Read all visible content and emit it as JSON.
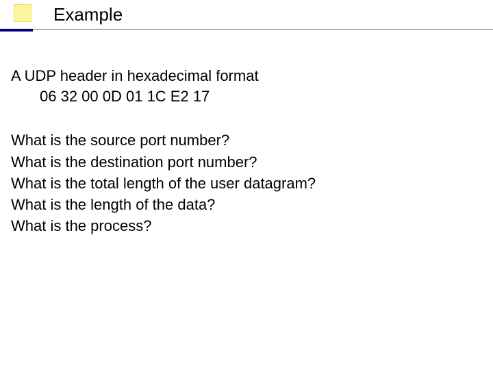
{
  "slide": {
    "title": "Example",
    "intro_line1": "A UDP header in hexadecimal format",
    "intro_line2": "06 32 00 0D 01 1C E2 17",
    "questions": {
      "q1": "What is the source port number?",
      "q2": "What is the destination port number?",
      "q3": "What is the total length of the user datagram?",
      "q4": "What is the length of the data?",
      "q5": "What is the process?"
    }
  }
}
